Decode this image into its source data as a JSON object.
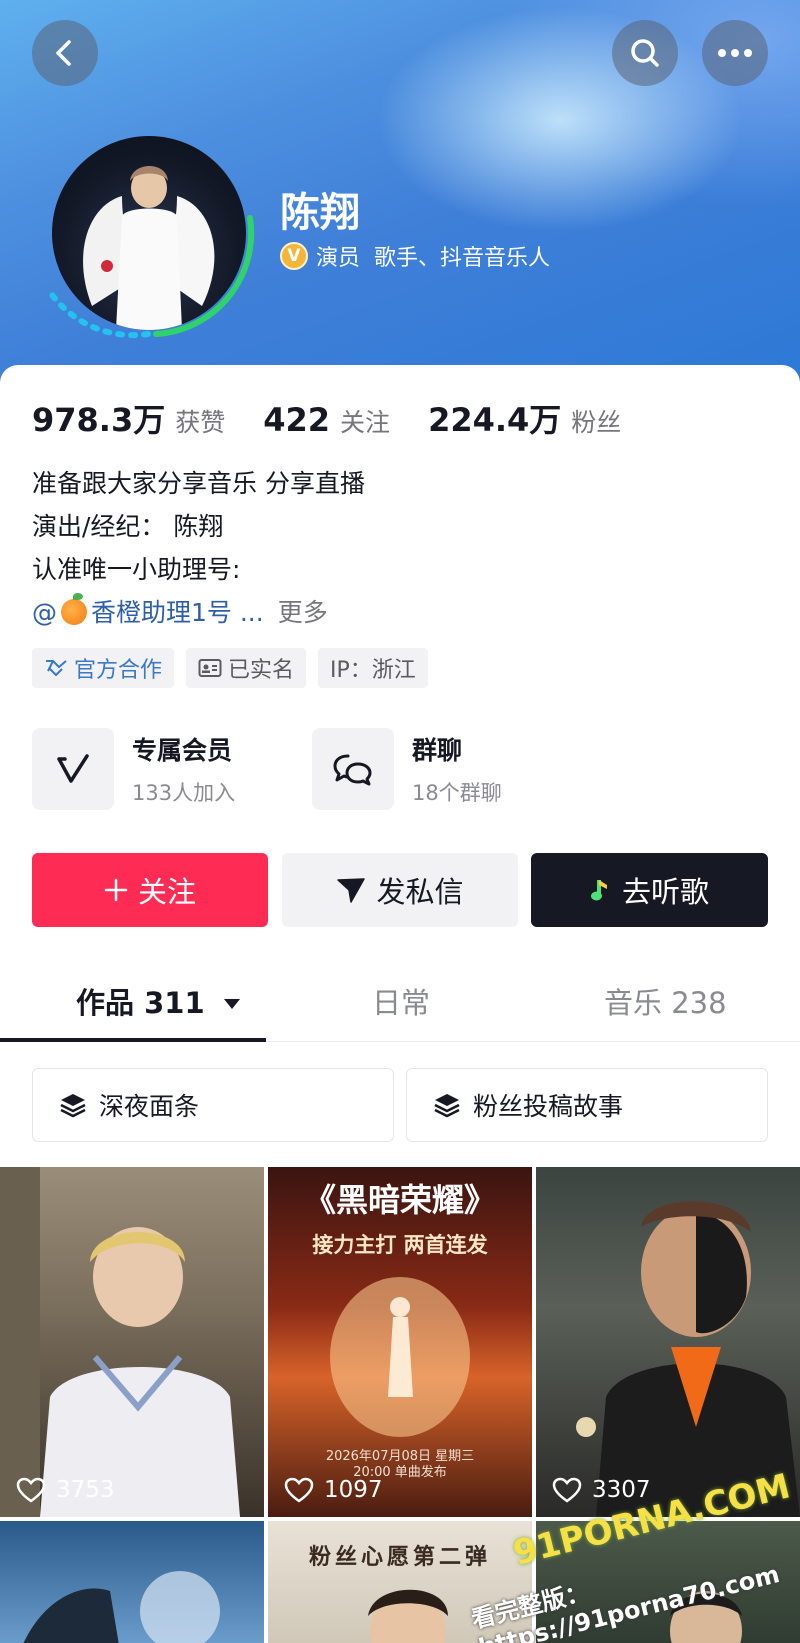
{
  "profile": {
    "name": "陈翔",
    "verify_text": "演员  歌手、抖音音乐人"
  },
  "stats": [
    {
      "value": "978.3万",
      "label": "获赞"
    },
    {
      "value": "422",
      "label": "关注"
    },
    {
      "value": "224.4万",
      "label": "粉丝"
    }
  ],
  "bio": {
    "line1": "准备跟大家分享音乐 分享直播",
    "line2": "演出/经纪： 陈翔",
    "line3": "认准唯一小助理号:",
    "link_prefix": "@",
    "link_text": "香橙助理1号 ...",
    "more": "更多"
  },
  "tags": [
    {
      "label": "官方合作",
      "icon": "handshake-icon"
    },
    {
      "label": "已实名",
      "icon": "id-card-icon"
    },
    {
      "label": "IP：浙江",
      "icon": ""
    }
  ],
  "features": [
    {
      "title": "专属会员",
      "sub": "133人加入",
      "icon": "member-v-icon"
    },
    {
      "title": "群聊",
      "sub": "18个群聊",
      "icon": "group-chat-icon"
    }
  ],
  "actions": {
    "follow": "关注",
    "message": "发私信",
    "music": "去听歌"
  },
  "tabs": [
    {
      "label": "作品 311",
      "active": true
    },
    {
      "label": "日常",
      "active": false
    },
    {
      "label": "音乐 238",
      "active": false
    }
  ],
  "collections": [
    "深夜面条",
    "粉丝投稿故事"
  ],
  "videos": [
    {
      "likes": "3753"
    },
    {
      "likes": "1097",
      "title": "《黑暗荣耀》",
      "subtitle": "接力主打 两首连发",
      "date": "2026年07月08日 星期三",
      "time": "20:00 单曲发布"
    },
    {
      "likes": "3307"
    }
  ],
  "videos_row2": [
    {
      "caption": ""
    },
    {
      "caption": "粉丝心愿第二弹"
    },
    {
      "caption": ""
    }
  ],
  "watermark": {
    "text": "91PORNA.COM",
    "sub": "看完整版：https://91porna70.com"
  },
  "colors": {
    "accent": "#fe2c55",
    "dark": "#161823",
    "link": "#2d5ea6"
  }
}
